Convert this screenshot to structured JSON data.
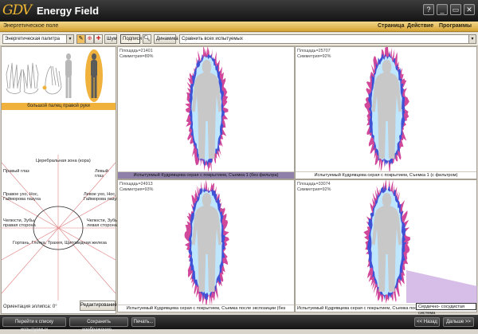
{
  "window": {
    "logo": "GDV",
    "title": "Energy Field",
    "help": "?",
    "minimize": "_",
    "restore": "▭",
    "close": "✕"
  },
  "menubar": {
    "subtitle": "Энергетическое поле",
    "items": [
      "Страница",
      "Действие",
      "Программы"
    ]
  },
  "toolbar": {
    "palette": "Энергетическая палитра",
    "noise_button": "Шум",
    "captions_button": "Подписи",
    "zoom_icon": "zoom-icon",
    "dynamics_button": "Динамика",
    "compare_select": "Сравнить всех испытуемых"
  },
  "left_panel": {
    "selected_finger": "большой палец правой руки",
    "zones": {
      "top": "Церебральная зона (кора)",
      "right_eye": "Правый глаз",
      "left_eye": "Левый глаз",
      "right_ear": "Правое ухо, Нос,\nГайморова пазуха",
      "left_ear": "Левое ухо, Нос,\nГайморова пазуха",
      "jaw_right": "Челюсти, Зубы\nправая сторона",
      "jaw_left": "Челюсти, Зубы\nлевая сторона",
      "bottom": "Гортань, Глотка, Трахея, Щитовидная железа"
    },
    "orientation": "Ориентация эллипса: 0°",
    "edit_button": "Редактирование"
  },
  "panels": [
    {
      "area": "Площадь=21401",
      "symmetry": "Симметрия=89%",
      "caption": "Испытуемый Кудрявцева серая с покрытием, Съемка 1 (без фильтра)",
      "active": true,
      "intensity": 0.42
    },
    {
      "area": "Площадь=25707",
      "symmetry": "Симметрия=92%",
      "caption": "Испытуемый Кудрявцева серая с покрытием, Съемка 1 (с фильтром)",
      "active": false,
      "intensity": 0.52
    },
    {
      "area": "Площадь=24913",
      "symmetry": "Симметрия=93%",
      "caption": "Испытуемый Кудрявцева серая с покрытием, Съемка после экспозиции (без фильтра)",
      "active": false,
      "intensity": 0.5
    },
    {
      "area": "Площадь=33074",
      "symmetry": "Симметрия=92%",
      "caption": "Испытуемый Кудрявцева серая с покрытием, Съемка после экспозиции (с фильтром)",
      "active": false,
      "intensity": 0.6
    }
  ],
  "tooltip": "Сердечно- сосудистая система",
  "bottom": {
    "back_to_list": "Перейти к списку испытуемых",
    "save_image": "Сохранить изображение...",
    "print": "Печать...",
    "prev": "<< Назад",
    "next": "Дальше >>"
  },
  "colors": {
    "aura_outer": "#d1489a",
    "aura_mid": "#3f52d6",
    "aura_inner": "#bfe6ff",
    "body": "#c8c8c8",
    "accent": "#f0b23c"
  }
}
